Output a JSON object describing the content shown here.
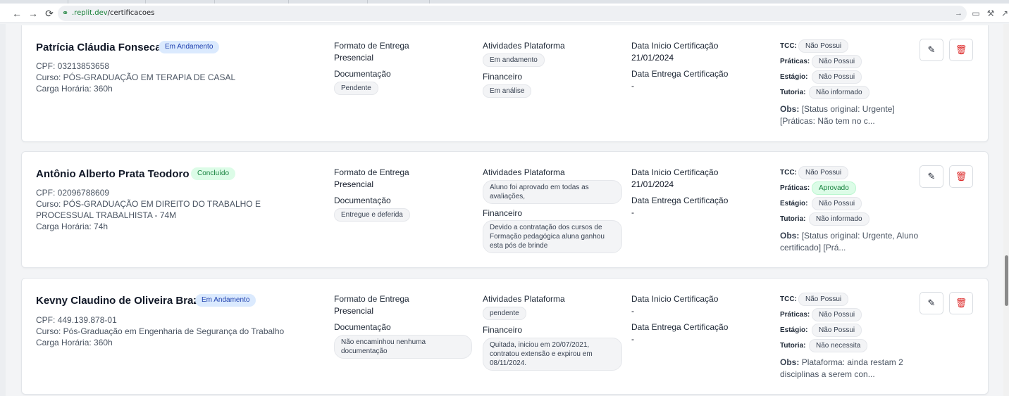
{
  "browser": {
    "url_domain": ".replit.dev",
    "url_path": "/certificacoes",
    "icons": {
      "back": "back-arrow-icon",
      "forward": "forward-arrow-icon",
      "reload": "reload-icon"
    }
  },
  "labels": {
    "formato": "Formato de Entrega",
    "documentacao": "Documentação",
    "atividades": "Atividades Plataforma",
    "financeiro": "Financeiro",
    "data_inicio": "Data Inicio Certificação",
    "data_entrega": "Data Entrega Certificação",
    "tcc": "TCC:",
    "praticas": "Práticas:",
    "estagio": "Estágio:",
    "tutoria": "Tutoria:",
    "obs": "Obs:"
  },
  "colors": {
    "em_andamento": "#dbeafe",
    "concluido": "#dcfce7",
    "delete": "#dc2626"
  },
  "records": [
    {
      "name": "Patrícia Cláudia Fonseca",
      "status": "Em Andamento",
      "cpf": "CPF: 03213853658",
      "curso": "Curso: PÓS-GRADUAÇÃO EM TERAPIA DE CASAL",
      "carga": "Carga Horária: 360h",
      "formato": "Presencial",
      "documentacao": "Pendente",
      "atividades": "Em andamento",
      "financeiro": "Em análise",
      "data_inicio": "21/01/2024",
      "data_entrega": "-",
      "tcc": "Não Possui",
      "praticas": "Não Possui",
      "estagio": "Não Possui",
      "tutoria": "Não informado",
      "obs": "[Status original: Urgente] [Práticas: Não tem no c..."
    },
    {
      "name": "Antônio Alberto Prata Teodoro",
      "status": "Concluído",
      "cpf": "CPF: 02096788609",
      "curso": "Curso: PÓS-GRADUAÇÃO EM DIREITO DO TRABALHO E PROCESSUAL TRABALHISTA - 74M",
      "carga": "Carga Horária: 74h",
      "formato": "Presencial",
      "documentacao": "Entregue e deferida",
      "atividades": "Aluno foi aprovado em todas as avaliações,",
      "financeiro": "Devido a contratação dos cursos de Formação pedagógica aluna ganhou esta pós de brinde",
      "data_inicio": "21/01/2024",
      "data_entrega": "-",
      "tcc": "Não Possui",
      "praticas": "Aprovado",
      "estagio": "Não Possui",
      "tutoria": "Não informado",
      "obs": "[Status original: Urgente, Aluno certificado] [Prá..."
    },
    {
      "name": "Kevny Claudino de Oliveira Braz",
      "status": "Em Andamento",
      "cpf": "CPF: 449.139.878-01",
      "curso": "Curso: Pós-Graduação em Engenharia de Segurança do Trabalho",
      "carga": "Carga Horária: 360h",
      "formato": "Presencial",
      "documentacao": "Não encaminhou nenhuma documentação",
      "atividades": "pendente",
      "financeiro": "Quitada, iniciou em 20/07/2021, contratou extensão e expirou em 08/11/2024.",
      "data_inicio": "-",
      "data_entrega": "-",
      "tcc": "Não Possui",
      "praticas": "Não Possui",
      "estagio": "Não Possui",
      "tutoria": "Não necessita",
      "obs": "Plataforma: ainda restam 2 disciplinas a serem con..."
    }
  ]
}
